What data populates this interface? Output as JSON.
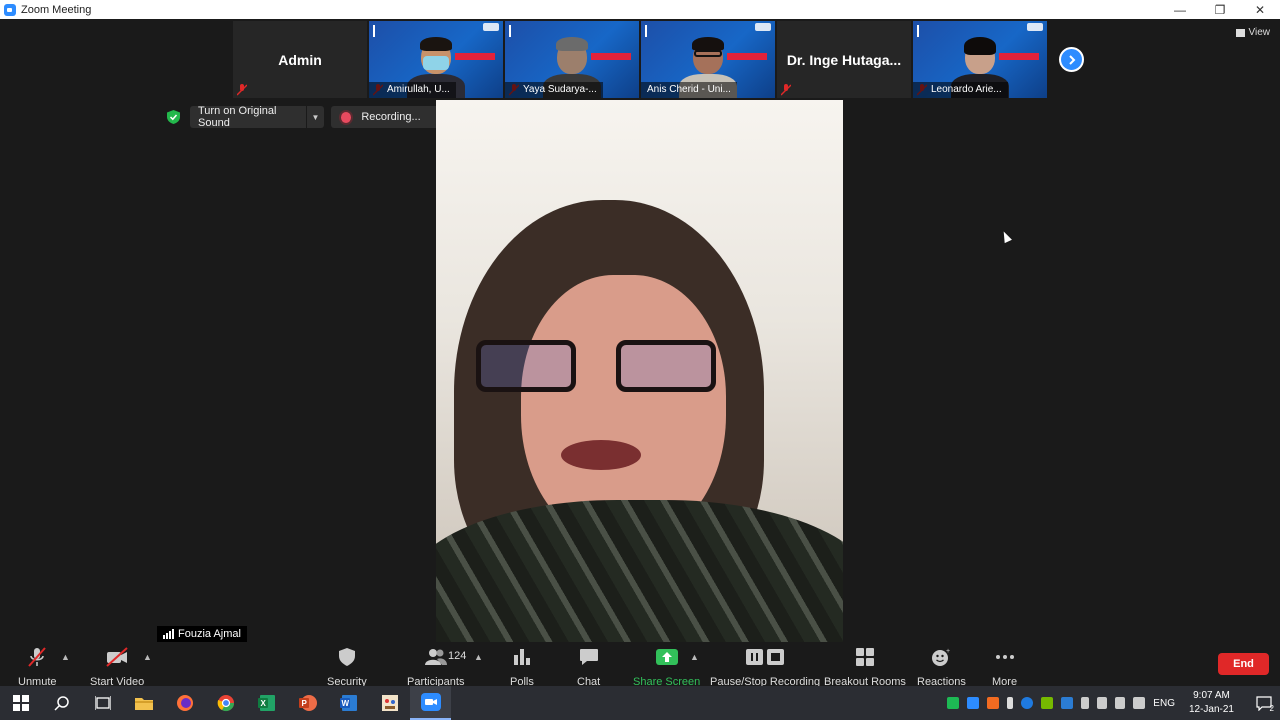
{
  "window": {
    "title": "Zoom Meeting"
  },
  "thumbnails": [
    {
      "name": "Admin",
      "type": "name-only"
    },
    {
      "name": "Amirullah, U...",
      "type": "video",
      "mask": true
    },
    {
      "name": "Yaya Sudarya-...",
      "type": "video"
    },
    {
      "name": "Anis Cherid - Uni...",
      "type": "video",
      "glasses": true
    },
    {
      "name": "Dr. Inge Hutaga...",
      "type": "name-only"
    },
    {
      "name": "Leonardo Arie...",
      "type": "video"
    }
  ],
  "view_label": "View",
  "original_sound_label": "Turn on Original Sound",
  "recording_label": "Recording...",
  "speaker_name": "Fouzia Ajmal",
  "toolbar": {
    "unmute": "Unmute",
    "start_video": "Start Video",
    "security": "Security",
    "participants": "Participants",
    "participants_count": "124",
    "polls": "Polls",
    "chat": "Chat",
    "share_screen": "Share Screen",
    "pause_stop_recording": "Pause/Stop Recording",
    "breakout_rooms": "Breakout Rooms",
    "reactions": "Reactions",
    "more": "More",
    "end": "End"
  },
  "taskbar": {
    "language": "ENG",
    "time": "9:07 AM",
    "date": "12-Jan-21",
    "notification_count": "2"
  },
  "colors": {
    "accent_blue": "#2d8cff",
    "end_red": "#e02828",
    "share_green": "#32c05a",
    "recording_red": "#e84a5f"
  }
}
